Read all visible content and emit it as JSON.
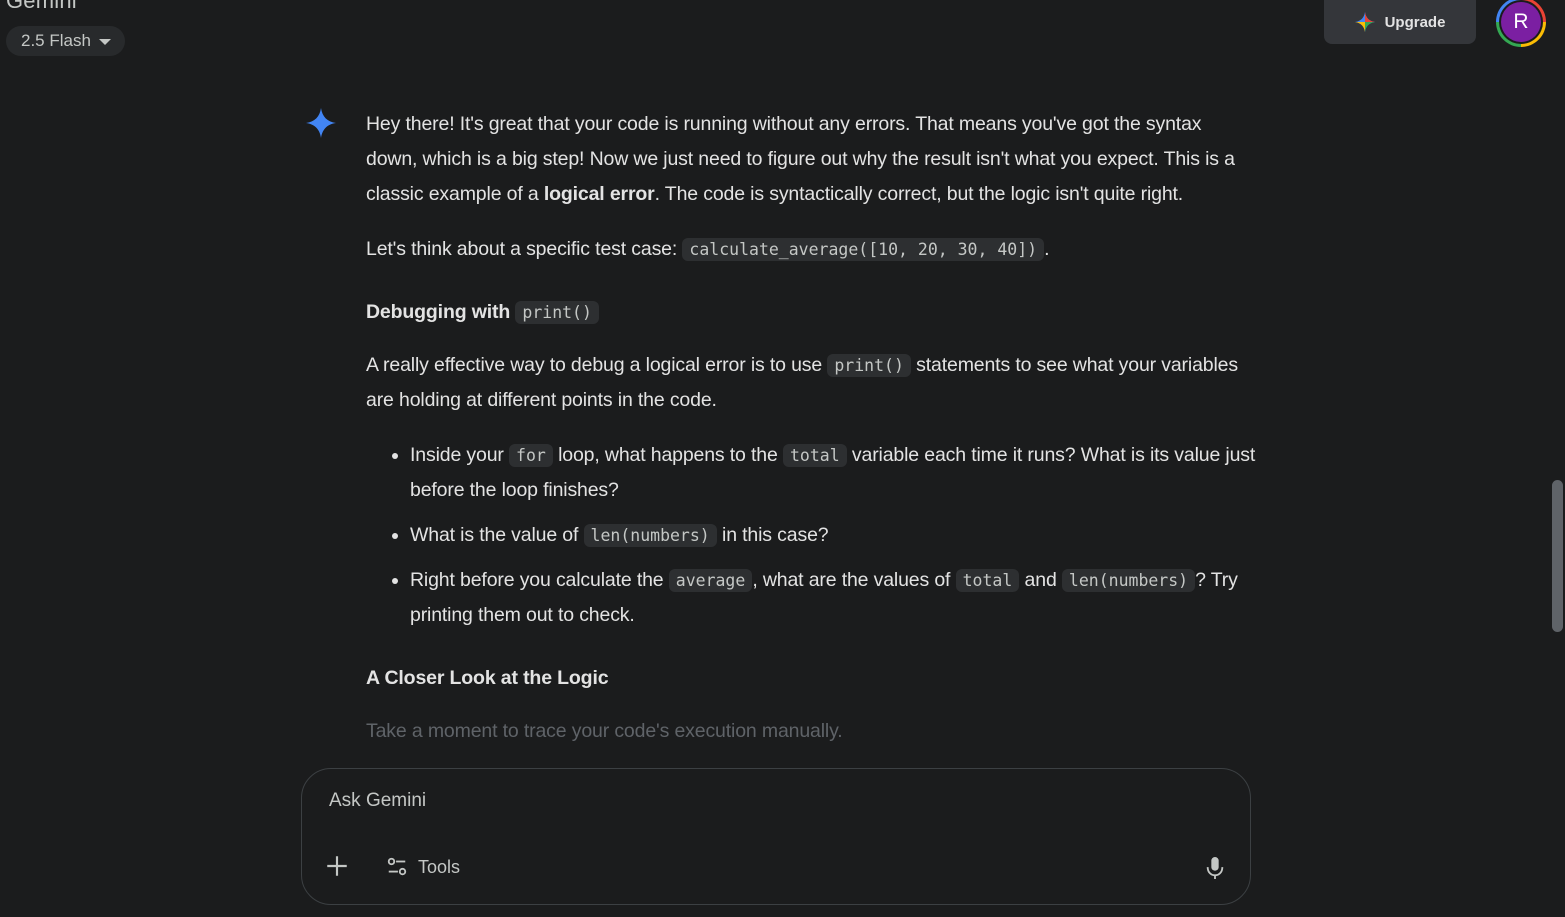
{
  "header": {
    "app_title": "Gemini",
    "model_label": "2.5 Flash",
    "upgrade_label": "Upgrade",
    "avatar_initial": "R"
  },
  "response": {
    "p1_a": "Hey there! It's great that your code is running without any errors. That means you've got the syntax down, which is a big step! Now we just need to figure out why the result isn't what you expect. This is a classic example of a ",
    "p1_bold": "logical error",
    "p1_b": ". The code is syntactically correct, but the logic isn't quite right.",
    "p2_a": "Let's think about a specific test case: ",
    "p2_code": "calculate_average([10, 20, 30, 40])",
    "p2_b": ".",
    "h1_text": "Debugging with ",
    "h1_code": "print()",
    "p3_a": "A really effective way to debug a logical error is to use ",
    "p3_code": "print()",
    "p3_b": " statements to see what your variables are holding at different points in the code.",
    "bullets": [
      {
        "a": "Inside your ",
        "c1": "for",
        "b": " loop, what happens to the ",
        "c2": "total",
        "d": " variable each time it runs? What is its value just before the loop finishes?"
      },
      {
        "a": "What is the value of ",
        "c1": "len(numbers)",
        "b": " in this case?"
      },
      {
        "a": "Right before you calculate the ",
        "c1": "average",
        "b": ", what are the values of ",
        "c2": "total",
        "d": " and ",
        "c3": "len(numbers)",
        "e": "? Try printing them out to check."
      }
    ],
    "h2_text": "A Closer Look at the Logic",
    "p4_text": "Take a moment to trace your code's execution manually."
  },
  "composer": {
    "placeholder": "Ask Gemini",
    "tools_label": "Tools"
  },
  "colors": {
    "background": "#1b1c1d",
    "text": "#e3e3e3",
    "code_bg": "#2d2f31",
    "spark": "#4285f4"
  },
  "icons": [
    "gemini-spark-icon",
    "caret-down-icon",
    "sparkle-icon",
    "plus-icon",
    "tools-icon",
    "mic-icon"
  ]
}
